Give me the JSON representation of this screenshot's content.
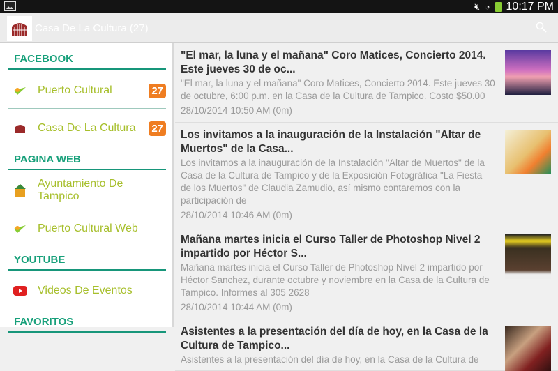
{
  "status_bar": {
    "time": "10:17 PM",
    "icons": [
      "gallery-icon",
      "mute-icon",
      "wifi-icon",
      "battery-icon"
    ]
  },
  "action_bar": {
    "title": "Casa De La Cultura (27)",
    "icons": [
      "casa-logo-icon",
      "search-icon"
    ]
  },
  "sidebar": {
    "sections": [
      {
        "title": "FACEBOOK",
        "items": [
          {
            "label": "Puerto Cultural",
            "badge": "27"
          },
          {
            "label": "Casa De La Cultura",
            "badge": "27"
          }
        ]
      },
      {
        "title": "PAGINA WEB",
        "items": [
          {
            "label": "Ayuntamiento De Tampico"
          },
          {
            "label": "Puerto Cultural Web"
          }
        ]
      },
      {
        "title": "YOUTUBE",
        "items": [
          {
            "label": "Videos De Eventos"
          }
        ]
      },
      {
        "title": "FAVORITOS",
        "items": []
      }
    ]
  },
  "posts": [
    {
      "title": "\"El mar, la luna y el mañana\" Coro Matices, Concierto 2014. Este jueves 30 de oc...",
      "desc": "\"El mar, la luna y el mañana\" Coro Matices, Concierto 2014. Este jueves 30 de octubre, 6:00 p.m. en la Casa de la Cultura de Tampico. Costo $50.00",
      "time": "28/10/2014 10:50 AM (0m)"
    },
    {
      "title": "Los invitamos a la inauguración de la Instalación \"Altar de Muertos\" de la Casa...",
      "desc": "Los invitamos a la inauguración de la Instalación \"Altar de Muertos\" de la Casa de la Cultura de Tampico y de la Exposición Fotográfica \"La Fiesta de los Muertos\" de Claudia Zamudio, así mismo contaremos con la participación de",
      "time": "28/10/2014 10:46 AM (0m)"
    },
    {
      "title": "Mañana martes inicia el Curso Taller de Photoshop Nivel 2 impartido por Héctor S...",
      "desc": "Mañana martes inicia el Curso Taller de Photoshop Nivel 2 impartido por Héctor Sanchez, durante octubre y noviembre en la Casa de la Cultura de Tampico. Informes al 305 2628",
      "time": "28/10/2014 10:44 AM (0m)"
    },
    {
      "title": "Asistentes a la presentación del día de hoy, en la Casa de la Cultura de Tampico...",
      "desc": "Asistentes a la presentación del día de hoy, en la Casa de la Cultura de",
      "time": ""
    }
  ]
}
